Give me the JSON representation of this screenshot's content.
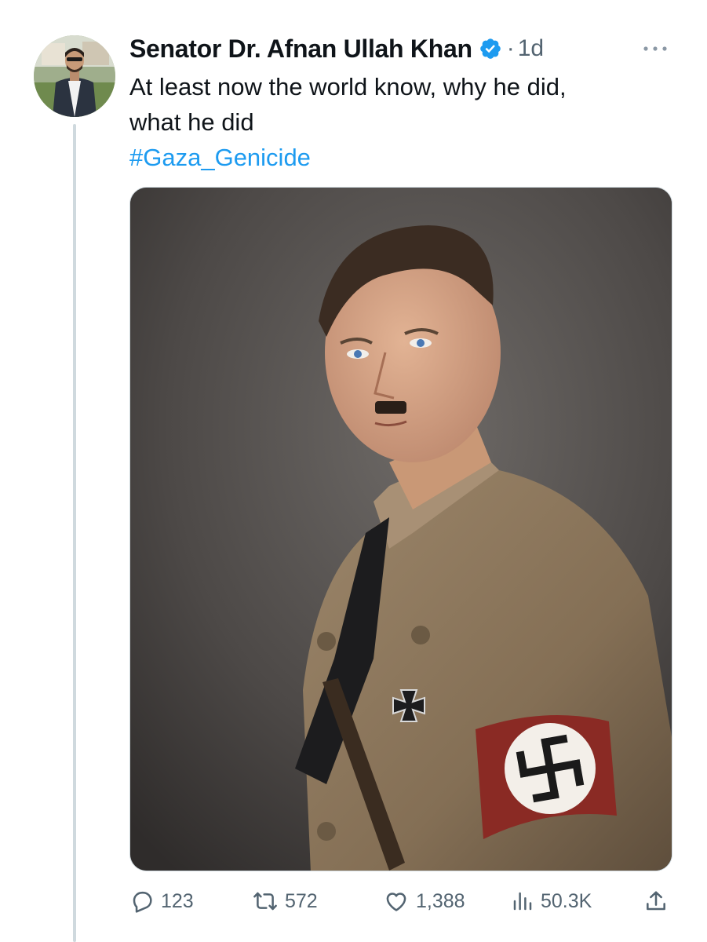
{
  "tweet": {
    "author_name": "Senator Dr. Afnan Ullah Khan",
    "verified": true,
    "separator": "·",
    "timestamp": "1d",
    "text_line_1": "At least now the world know, why he did,",
    "text_line_2": "what he did",
    "hashtag": "#Gaza_Genicide"
  },
  "actions": {
    "replies": "123",
    "reposts": "572",
    "likes": "1,388",
    "views": "50.3K"
  },
  "icons": {
    "verified": "verified-badge-icon",
    "more": "more-options-icon",
    "reply": "reply-icon",
    "repost": "repost-icon",
    "like": "heart-icon",
    "views": "views-chart-icon",
    "share": "share-icon"
  },
  "colors": {
    "text": "#0f1419",
    "secondary": "#536471",
    "link": "#1d9bf0",
    "verified": "#1d9bf0"
  }
}
